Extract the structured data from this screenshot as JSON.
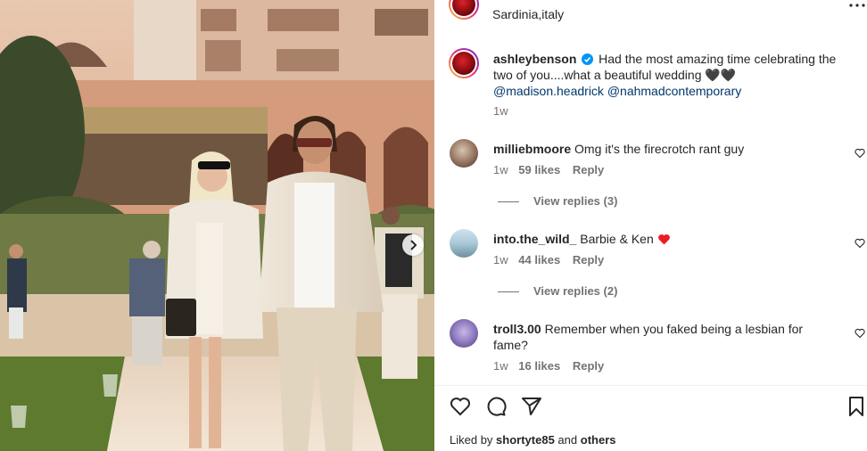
{
  "post": {
    "location": "Sardinia,italy",
    "author": "ashleybenson",
    "caption": "Had the most amazing time celebrating the",
    "caption_line2": "two of you....what a beautiful wedding",
    "caption_emoji": "🖤🖤",
    "mention1": "@madison.headrick",
    "mention2": "@nahmadcontemporary",
    "time": "1w"
  },
  "comments": [
    {
      "user": "milliebmoore",
      "text": "Omg it's the firecrotch rant guy",
      "time": "1w",
      "likes": "59 likes",
      "reply": "Reply",
      "view_replies": "View replies (3)"
    },
    {
      "user": "into.the_wild_",
      "text": "Barbie & Ken",
      "time": "1w",
      "likes": "44 likes",
      "reply": "Reply",
      "view_replies": "View replies (2)"
    },
    {
      "user": "troll3.00",
      "text": "Remember when you faked being a lesbian for",
      "text2": "fame?",
      "time": "1w",
      "likes": "16 likes",
      "reply": "Reply"
    }
  ],
  "footer": {
    "liked_prefix": "Liked by",
    "liked_user": "shortyte85",
    "liked_and": "and",
    "liked_others": "others"
  },
  "icons": {
    "like": "heart-icon",
    "comment": "comment-icon",
    "share": "send-icon",
    "save": "bookmark-icon",
    "more": "more-options-icon",
    "next": "chevron-right-icon",
    "verified": "verified-badge-icon"
  },
  "colors": {
    "verified": "#0095f6",
    "red_heart": "#ed1c24",
    "link": "#00376b",
    "muted": "#737373"
  }
}
